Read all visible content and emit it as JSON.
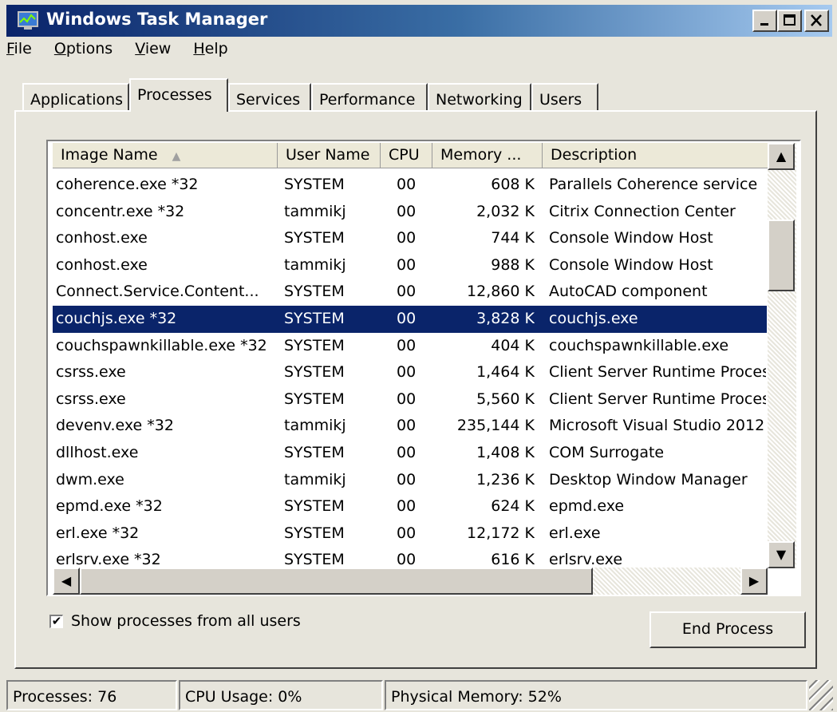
{
  "window": {
    "title": "Windows Task Manager",
    "minimize": "_",
    "maximize": "□",
    "close": "×"
  },
  "menu": [
    "File",
    "Options",
    "View",
    "Help"
  ],
  "tabs": [
    "Applications",
    "Processes",
    "Services",
    "Performance",
    "Networking",
    "Users"
  ],
  "active_tab": "Processes",
  "table": {
    "columns": [
      "Image Name",
      "User Name",
      "CPU",
      "Memory ...",
      "Description"
    ],
    "sort_indicator": "▲",
    "rows": [
      {
        "name": "coherence.exe *32",
        "user": "SYSTEM",
        "cpu": "00",
        "mem": "608 K",
        "desc": "Parallels Coherence service"
      },
      {
        "name": "concentr.exe *32",
        "user": "tammikj",
        "cpu": "00",
        "mem": "2,032 K",
        "desc": "Citrix Connection Center"
      },
      {
        "name": "conhost.exe",
        "user": "SYSTEM",
        "cpu": "00",
        "mem": "744 K",
        "desc": "Console Window Host"
      },
      {
        "name": "conhost.exe",
        "user": "tammikj",
        "cpu": "00",
        "mem": "988 K",
        "desc": "Console Window Host"
      },
      {
        "name": "Connect.Service.Content...",
        "user": "SYSTEM",
        "cpu": "00",
        "mem": "12,860 K",
        "desc": "AutoCAD component"
      },
      {
        "name": "couchjs.exe *32",
        "user": "SYSTEM",
        "cpu": "00",
        "mem": "3,828 K",
        "desc": "couchjs.exe"
      },
      {
        "name": "couchspawnkillable.exe *32",
        "user": "SYSTEM",
        "cpu": "00",
        "mem": "404 K",
        "desc": "couchspawnkillable.exe"
      },
      {
        "name": "csrss.exe",
        "user": "SYSTEM",
        "cpu": "00",
        "mem": "1,464 K",
        "desc": "Client Server Runtime Process"
      },
      {
        "name": "csrss.exe",
        "user": "SYSTEM",
        "cpu": "00",
        "mem": "5,560 K",
        "desc": "Client Server Runtime Process"
      },
      {
        "name": "devenv.exe *32",
        "user": "tammikj",
        "cpu": "00",
        "mem": "235,144 K",
        "desc": "Microsoft Visual Studio 2012"
      },
      {
        "name": "dllhost.exe",
        "user": "SYSTEM",
        "cpu": "00",
        "mem": "1,408 K",
        "desc": "COM Surrogate"
      },
      {
        "name": "dwm.exe",
        "user": "tammikj",
        "cpu": "00",
        "mem": "1,236 K",
        "desc": "Desktop Window Manager"
      },
      {
        "name": "epmd.exe *32",
        "user": "SYSTEM",
        "cpu": "00",
        "mem": "624 K",
        "desc": "epmd.exe"
      },
      {
        "name": "erl.exe *32",
        "user": "SYSTEM",
        "cpu": "00",
        "mem": "12,172 K",
        "desc": "erl.exe"
      },
      {
        "name": "erlsrv.exe *32",
        "user": "SYSTEM",
        "cpu": "00",
        "mem": "616 K",
        "desc": "erlsrv.exe"
      }
    ],
    "selected_row": "couchjs.exe *32"
  },
  "show_all_users": {
    "label": "Show processes from all users",
    "checked": "✔"
  },
  "end_process_label": "End Process",
  "status": {
    "processes": "Processes: 76",
    "cpu": "CPU Usage: 0%",
    "memory": "Physical Memory: 52%"
  }
}
